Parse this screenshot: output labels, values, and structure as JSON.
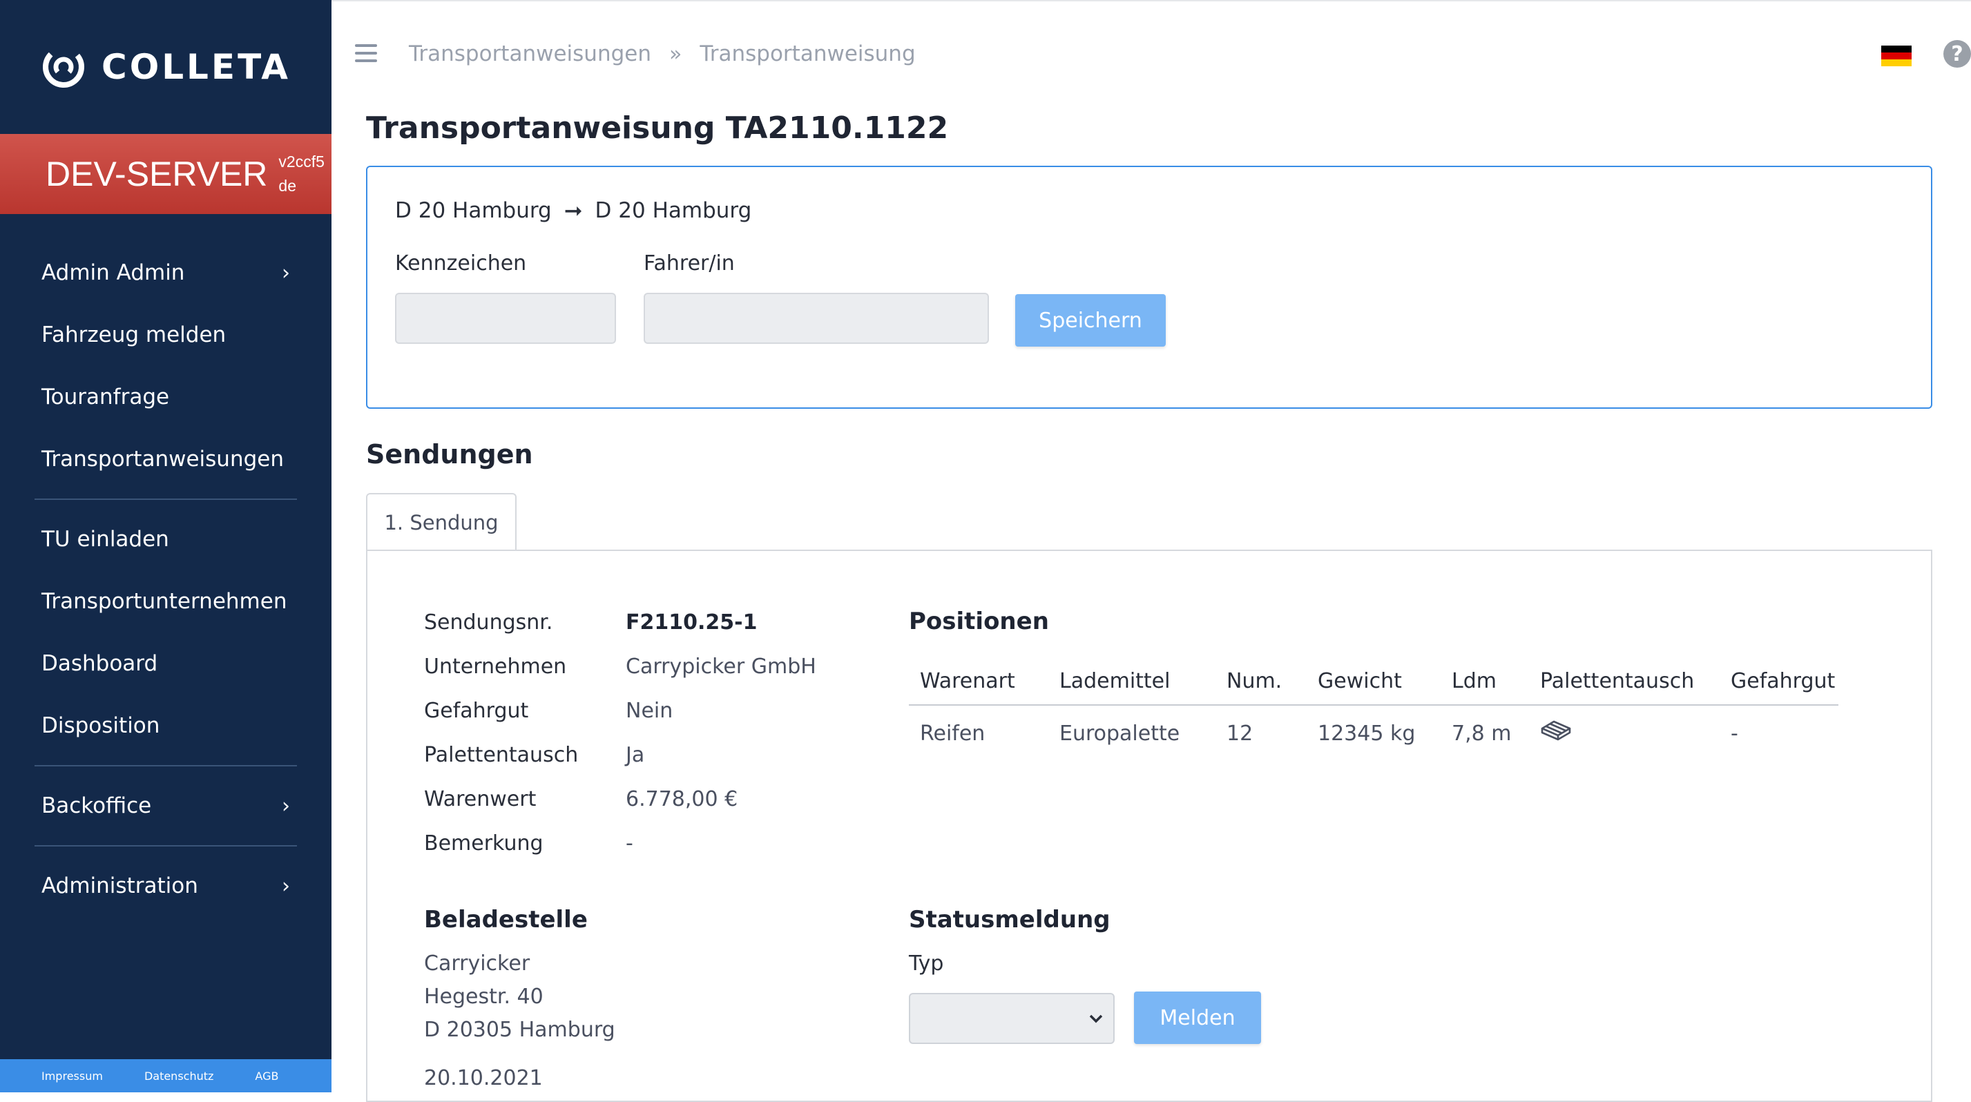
{
  "brand": {
    "name": "COLLETA"
  },
  "env": {
    "name": "DEV-SERVER",
    "version": "v2ccf5",
    "locale": "de"
  },
  "nav": {
    "items": [
      {
        "label": "Admin Admin",
        "chevron": true
      },
      {
        "label": "Fahrzeug melden",
        "chevron": false
      },
      {
        "label": "Touranfrage",
        "chevron": false
      },
      {
        "label": "Transportanweisungen",
        "chevron": false
      },
      {
        "label": "TU einladen",
        "chevron": false
      },
      {
        "label": "Transportunternehmen",
        "chevron": false
      },
      {
        "label": "Dashboard",
        "chevron": false
      },
      {
        "label": "Disposition",
        "chevron": false
      },
      {
        "label": "Backoffice",
        "chevron": true
      },
      {
        "label": "Administration",
        "chevron": true
      }
    ],
    "chevron_glyph": "›"
  },
  "footer": {
    "links": [
      "Impressum",
      "Datenschutz",
      "AGB"
    ]
  },
  "breadcrumb": {
    "items": [
      "Transportanweisungen",
      "Transportanweisung"
    ],
    "separator": "»"
  },
  "icons": {
    "menu": "hamburger-icon",
    "language": "german-flag-icon",
    "help": "help-icon",
    "pallet": "pallet-icon"
  },
  "page": {
    "title": "Transportanweisung TA2110.1122"
  },
  "route": {
    "from": "D 20 Hamburg",
    "arrow": "➞",
    "to": "D 20 Hamburg",
    "plate_label": "Kennzeichen",
    "plate_value": "",
    "driver_label": "Fahrer/in",
    "driver_value": "",
    "save_label": "Speichern"
  },
  "shipments": {
    "title": "Sendungen",
    "tabs": [
      "1. Sendung"
    ],
    "details": [
      {
        "label": "Sendungsnr.",
        "value": "F2110.25-1"
      },
      {
        "label": "Unternehmen",
        "value": "Carrypicker GmbH"
      },
      {
        "label": "Gefahrgut",
        "value": "Nein"
      },
      {
        "label": "Palettentausch",
        "value": "Ja"
      },
      {
        "label": "Warenwert",
        "value": "6.778,00 €"
      },
      {
        "label": "Bemerkung",
        "value": "-"
      }
    ],
    "loading": {
      "title": "Beladestelle",
      "lines": [
        "Carryicker",
        "Hegestr. 40",
        "D 20305 Hamburg"
      ],
      "date": "20.10.2021"
    },
    "positions": {
      "title": "Positionen",
      "columns": [
        "Warenart",
        "Lademittel",
        "Num.",
        "Gewicht",
        "Ldm",
        "Palettentausch",
        "Gefahrgut"
      ],
      "rows": [
        {
          "Warenart": "Reifen",
          "Lademittel": "Europalette",
          "Num": "12",
          "Gewicht": "12345 kg",
          "Ldm": "7,8 m",
          "Palettentausch": "pallet-icon",
          "Gefahrgut": "-"
        }
      ]
    },
    "status": {
      "title": "Statusmeldung",
      "type_label": "Typ",
      "type_value": "",
      "report_label": "Melden"
    }
  }
}
